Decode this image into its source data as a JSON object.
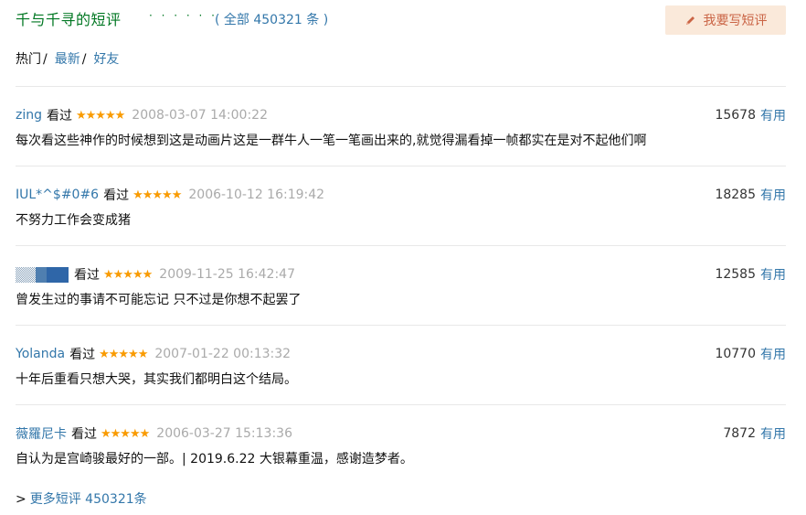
{
  "header": {
    "title": "千与千寻的短评",
    "dots": "· · · · · ·",
    "total_open": "( ",
    "total_label": "全部 450321 条",
    "total_close": " )",
    "write_button": "我要写短评",
    "write_icon": "pencil-icon"
  },
  "tabs": [
    {
      "label": "热门",
      "active": true
    },
    {
      "label": "最新",
      "active": false
    },
    {
      "label": "好友",
      "active": false
    }
  ],
  "tab_separator": "/",
  "comments": [
    {
      "user": "zing",
      "watched": "看过",
      "rating": 5,
      "stars": "★★★★★",
      "time": "2008-03-07 14:00:22",
      "votes": "15678",
      "useful": "有用",
      "content": "每次看这些神作的时候想到这是动画片这是一群牛人一笔一笔画出来的,就觉得漏看掉一帧都实在是对不起他们啊"
    },
    {
      "user": "IUL*^$#0#6",
      "watched": "看过",
      "rating": 5,
      "stars": "★★★★★",
      "time": "2006-10-12 16:19:42",
      "votes": "18285",
      "useful": "有用",
      "content": "不努力工作会变成猪"
    },
    {
      "user": "",
      "watched": "看过",
      "rating": 5,
      "stars": "★★★★★",
      "time": "2009-11-25 16:42:47",
      "votes": "12585",
      "useful": "有用",
      "content": "曾发生过的事请不可能忘记 只不过是你想不起罢了"
    },
    {
      "user": "Yolanda",
      "watched": "看过",
      "rating": 5,
      "stars": "★★★★★",
      "time": "2007-01-22 00:13:32",
      "votes": "10770",
      "useful": "有用",
      "content": "十年后重看只想大哭，其实我们都明白这个结局。"
    },
    {
      "user": "薇羅尼卡",
      "watched": "看过",
      "rating": 5,
      "stars": "★★★★★",
      "time": "2006-03-27 15:13:36",
      "votes": "7872",
      "useful": "有用",
      "content": "自认为是宫崎骏最好的一部。| 2019.6.22 大银幕重温，感谢造梦者。"
    }
  ],
  "more": {
    "arrow": ">",
    "label": "更多短评 450321条"
  },
  "colors": {
    "title_green": "#007722",
    "link_blue": "#3377aa",
    "star_orange": "#f99b01",
    "time_gray": "#aaaaaa",
    "button_bg": "#fae9da",
    "button_text": "#ca6445"
  }
}
